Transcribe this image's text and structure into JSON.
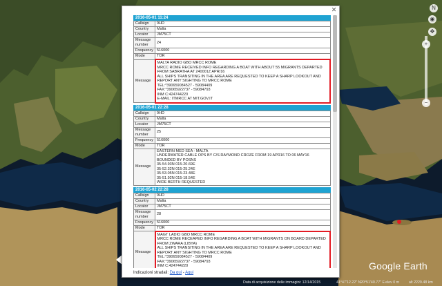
{
  "entries": [
    {
      "date": "2016-05-01 11:24",
      "callsign_label": "Callsign",
      "callsign": "9HD",
      "country_label": "Country",
      "country": "Malta",
      "locator_label": "Locator",
      "locator": "JM75CT",
      "msgnum_label": "Message number",
      "msgnum": "24",
      "freq_label": "Frequency",
      "freq": "516000",
      "mode_label": "Mode",
      "mode": "TOR",
      "message_label": "Message",
      "message": "MALTA RADIO GBO MRCC ROME\nMRCC ROME RECEIVED INFO REGARDING A BOAT WITH ABOUT 55 MIGRANTS DEPARTED FROM SABRATHA AT 240001Z APR/16\nALL SHIPS TRANSITING IN THE AREA ARE REQUESTED TO KEEP A SHARP LOOKOUT AND REPORT ANY SIGHTING TO MRCC ROME\nTEL:*390659084527 - 59084409\nFAX:*39065922737 - 59084793\nINM C:424744220\nE-MAIL: ITMRCC AT MIT.GOV.IT",
      "highlight": true
    },
    {
      "date": "2016-05-01 22:28",
      "callsign_label": "Callsign",
      "callsign": "9HD",
      "country_label": "Country",
      "country": "Malta",
      "locator_label": "Locator",
      "locator": "JM75CT",
      "msgnum_label": "Message number",
      "msgnum": "25",
      "freq_label": "Frequency",
      "freq": "516000",
      "mode_label": "Mode",
      "mode": "TOR",
      "message_label": "Message",
      "message": "EASTERN MED SEA - MALTA\nUNDERWATER CABLE OPS BY C/S RAYMOND CROZE FROM 19 APR16 TO 06 MAY16 BOUNDED BY POSNS\n35-54.93N 015-20.69E\n35-52.32N 015-25.24E\n35-53.05N 015-23.48E\n35-51.92N 015-18.54E\nWIDE BERTH REQUESTED",
      "highlight": false
    },
    {
      "date": "2016-05-02 22:28",
      "callsign_label": "Callsign",
      "callsign": "9HD",
      "country_label": "Country",
      "country": "Malta",
      "locator_label": "Locator",
      "locator": "JM75CT",
      "msgnum_label": "Message number",
      "msgnum": "28",
      "freq_label": "Frequency",
      "freq": "516000",
      "mode_label": "Mode",
      "mode": "TOR",
      "message_label": "Message",
      "message": "MAGT LADIO GBO MRCC ROME\nMRCC ROME RECEAPED INFO REGARDING A BOAT WITH MIGRANTS ON BOARD DEPARTED FROM ZWARA (LIBYA)\nALL SHIPS TRANSITING IN THE AREA ARE REQUESTED TO KEEP A SHARP LOOKOUT AND REPORT ANY SIGHTING TO MRCC ROME\nTEL:*390659084527 - 59084409\nFAX:*39065922737 - 59084793\nINM C:424744220\nE-MAIL: ITMRCC AT MIT.GOV.IT",
      "highlight": true
    }
  ],
  "footer": {
    "prefix": "Indicazioni stradali:",
    "link1": "Da qui",
    "sep": " - ",
    "link2": "Aqui"
  },
  "brand": "Google Earth",
  "status": {
    "acq_date": "Data di acquisizione delle immagini: 12/14/2015",
    "lat": "41°47'12.22\" N",
    "lon": "20°51'40.77\" E",
    "elev": "elev 0 m",
    "eye": "alt 2229.48 km"
  },
  "colors": {
    "date_bar": "#1fa3d2",
    "highlight": "#e21b24"
  }
}
